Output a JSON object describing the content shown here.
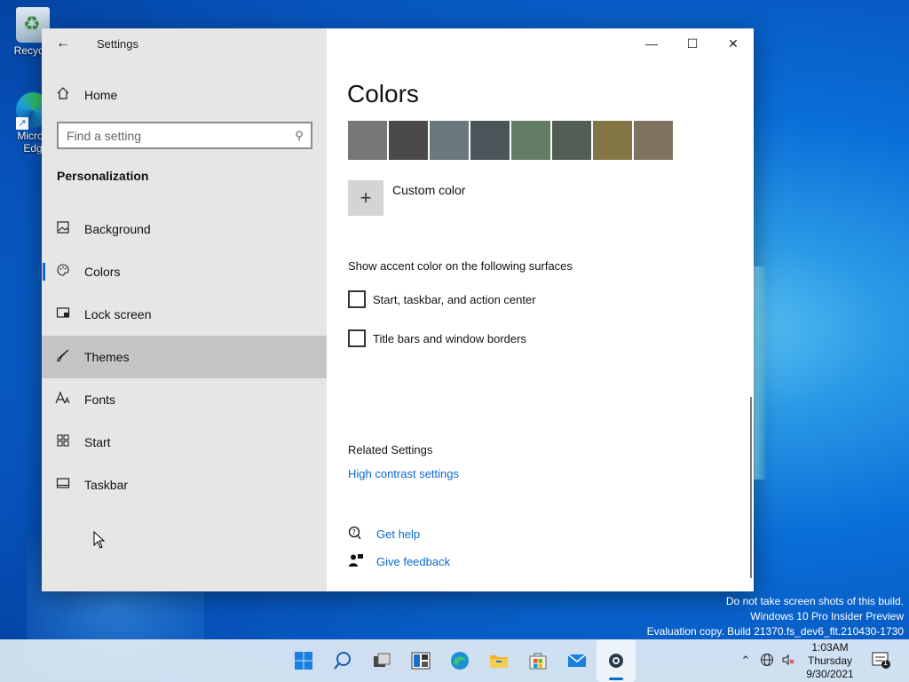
{
  "desktop": {
    "icons": [
      {
        "label": "Recycle",
        "icon": "recycle-bin-icon"
      },
      {
        "label": "Micros\nEdg",
        "icon": "edge-icon"
      }
    ]
  },
  "window": {
    "title": "Settings",
    "back_icon": "back-arrow-icon",
    "caption": {
      "minimize": "—",
      "maximize": "☐",
      "close": "✕"
    }
  },
  "sidebar": {
    "home_label": "Home",
    "search_placeholder": "Find a setting",
    "section_title": "Personalization",
    "items": [
      {
        "label": "Background",
        "icon": "background-icon"
      },
      {
        "label": "Colors",
        "icon": "palette-icon",
        "selected": true
      },
      {
        "label": "Lock screen",
        "icon": "lock-screen-icon"
      },
      {
        "label": "Themes",
        "icon": "brush-icon",
        "hover": true
      },
      {
        "label": "Fonts",
        "icon": "fonts-icon"
      },
      {
        "label": "Start",
        "icon": "start-icon"
      },
      {
        "label": "Taskbar",
        "icon": "taskbar-icon"
      }
    ]
  },
  "content": {
    "title": "Colors",
    "swatches": [
      "#767676",
      "#4c4a48",
      "#69797e",
      "#4a5459",
      "#647c64",
      "#525e54",
      "#847545",
      "#7e735f"
    ],
    "custom_color_label": "Custom color",
    "surfaces_label": "Show accent color on the following surfaces",
    "checkboxes": [
      {
        "label": "Start, taskbar, and action center",
        "checked": false
      },
      {
        "label": "Title bars and window borders",
        "checked": false
      }
    ],
    "related_label": "Related Settings",
    "related_link": "High contrast settings",
    "get_help": "Get help",
    "give_feedback": "Give feedback"
  },
  "watermark": {
    "line1": "Do not take screen shots of this build.",
    "line2": "Windows 10 Pro Insider Preview",
    "line3": "Evaluation copy. Build 21370.fs_dev6_flt.210430-1730"
  },
  "taskbar": {
    "apps": [
      "start-icon",
      "search-icon",
      "task-view-icon",
      "widgets-icon",
      "edge-icon",
      "file-explorer-icon",
      "store-icon",
      "mail-icon",
      "settings-icon"
    ],
    "clock": {
      "time": "1:03AM",
      "day": "Thursday",
      "date": "9/30/2021"
    },
    "notification_count": "1",
    "accent": "#0a6ad3"
  }
}
